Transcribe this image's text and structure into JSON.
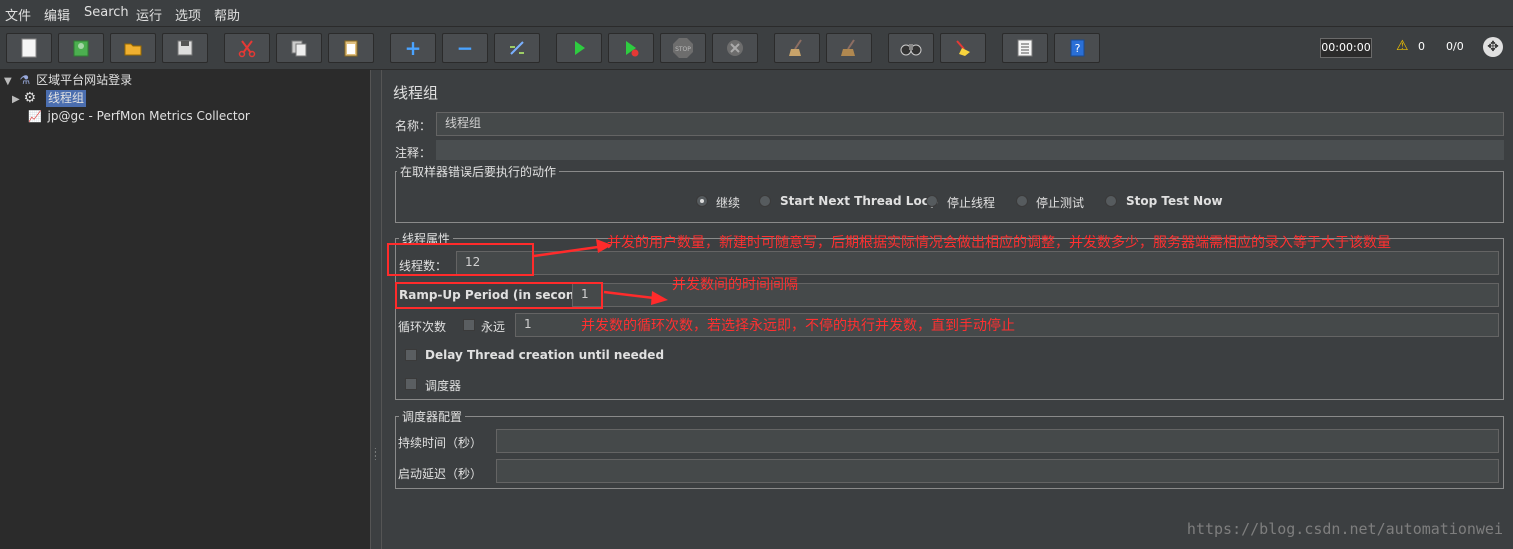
{
  "menu": [
    "文件",
    "编辑",
    "Search",
    "运行",
    "选项",
    "帮助"
  ],
  "toolbar": {
    "timer": "00:00:00",
    "warning_count": "0",
    "thread_ratio": "0/0"
  },
  "tree": {
    "root": "区域平台网站登录",
    "thread_group": "线程组",
    "collector": "jp@gc - PerfMon Metrics Collector"
  },
  "panel": {
    "title": "线程组",
    "name_label": "名称：",
    "name_value": "线程组",
    "comment_label": "注释：",
    "comment_value": "",
    "error_section": {
      "legend": "在取样器错误后要执行的动作",
      "options": [
        {
          "label": "继续",
          "selected": true
        },
        {
          "label": "Start Next Thread Loop",
          "selected": false
        },
        {
          "label": "停止线程",
          "selected": false
        },
        {
          "label": "停止测试",
          "selected": false
        },
        {
          "label": "Stop Test Now",
          "selected": false
        }
      ]
    },
    "thread_props": {
      "legend": "线程属性",
      "threads_label": "线程数：",
      "threads_value": "12",
      "rampup_label": "Ramp-Up Period (in seconds):",
      "rampup_value": "1",
      "loop_label": "循环次数",
      "forever_label": "永远",
      "forever_checked": false,
      "loop_value": "1",
      "delay_label": "Delay Thread creation until needed",
      "delay_checked": false,
      "scheduler_label": "调度器",
      "scheduler_checked": false
    },
    "scheduler_config": {
      "legend": "调度器配置",
      "duration_label": "持续时间（秒）",
      "duration_value": "",
      "delay_label": "启动延迟（秒）",
      "delay_value": ""
    }
  },
  "annotations": {
    "threads": "并发的用户数量，新建时可随意写，后期根据实际情况会做出相应的调整，并发数多少，服务器端需相应的录入等于大于该数量",
    "rampup": "并发数间的时间间隔",
    "loop": "并发数的循环次数，若选择永远即，不停的执行并发数，直到手动停止"
  },
  "watermark": "https://blog.csdn.net/automationwei",
  "colors": {
    "background": "#3c3f41",
    "tree_background": "#2b2b2b",
    "selection": "#4b6eaf",
    "annotation_red": "#ff3030"
  }
}
